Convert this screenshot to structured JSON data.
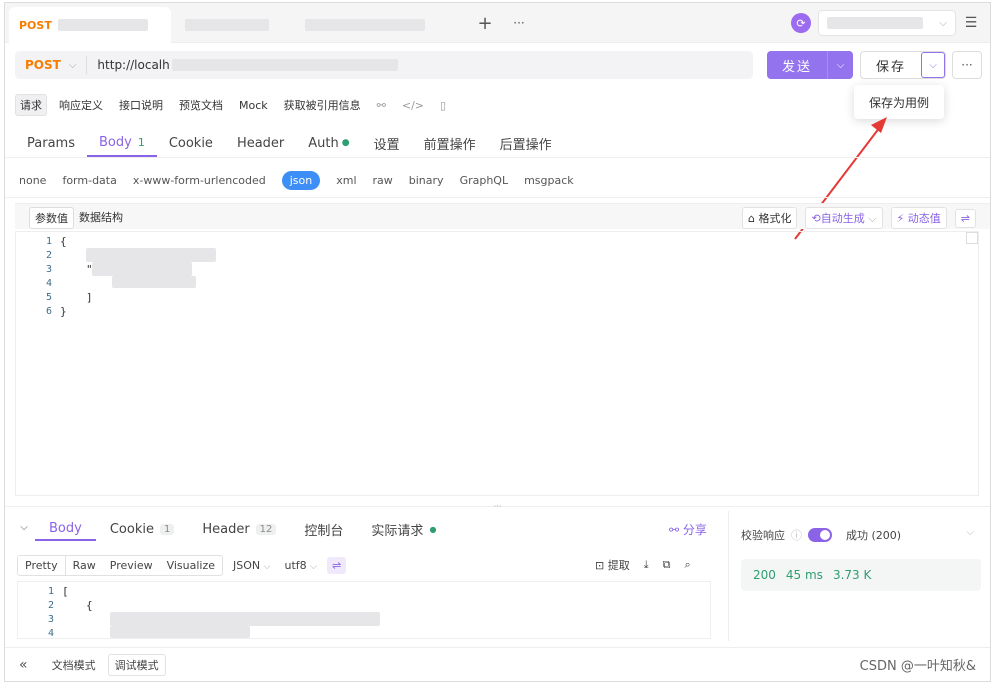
{
  "tabs": [
    {
      "method": "POST",
      "active": true
    },
    {
      "method": "",
      "active": false
    },
    {
      "method": "",
      "active": false
    }
  ],
  "tabbar": {
    "add": "+",
    "more": "···",
    "menu": "☰"
  },
  "request": {
    "method": "POST",
    "url": "http://localh",
    "send_label": "发送",
    "save_label": "保存",
    "dropdown_item": "保存为用例"
  },
  "subtabs": [
    "请求",
    "响应定义",
    "接口说明",
    "预览文档",
    "Mock",
    "获取被引用信息"
  ],
  "request_tabs": [
    {
      "label": "Params"
    },
    {
      "label": "Body",
      "count": "1"
    },
    {
      "label": "Cookie"
    },
    {
      "label": "Header"
    },
    {
      "label": "Auth"
    },
    {
      "label": "设置"
    },
    {
      "label": "前置操作"
    },
    {
      "label": "后置操作"
    }
  ],
  "body_types": [
    "none",
    "form-data",
    "x-www-form-urlencoded",
    "json",
    "xml",
    "raw",
    "binary",
    "GraphQL",
    "msgpack"
  ],
  "param_toolbar": {
    "tab1": "参数值",
    "tab2": "数据结构",
    "format": "格式化",
    "auto_gen": "自动生成",
    "dynamic": "动态值"
  },
  "code_lines": [
    {
      "n": "1",
      "text": "{"
    },
    {
      "n": "2",
      "text": ""
    },
    {
      "n": "3",
      "text": "\""
    },
    {
      "n": "4",
      "text": ""
    },
    {
      "n": "5",
      "text": "]"
    },
    {
      "n": "6",
      "text": "}"
    }
  ],
  "response_tabs": [
    {
      "label": "Body"
    },
    {
      "label": "Cookie",
      "count": "1"
    },
    {
      "label": "Header",
      "count": "12"
    },
    {
      "label": "控制台"
    },
    {
      "label": "实际请求"
    }
  ],
  "share_label": "分享",
  "format_modes": [
    "Pretty",
    "Raw",
    "Preview",
    "Visualize"
  ],
  "format_type": "JSON",
  "encoding": "utf8",
  "extract_label": "提取",
  "response_lines": [
    {
      "n": "1",
      "text": "["
    },
    {
      "n": "2",
      "text": "{"
    },
    {
      "n": "3",
      "text": ""
    },
    {
      "n": "4",
      "text": ""
    }
  ],
  "validate": {
    "label": "校验响应",
    "result": "成功 (200)"
  },
  "status": {
    "code": "200",
    "time": "45 ms",
    "size": "3.73 K"
  },
  "footer": {
    "doc_mode": "文档模式",
    "debug_mode": "调试模式",
    "right_text": "CSDN @一叶知秋&"
  },
  "colors": {
    "accent": "#8a63e6",
    "method": "#f77d00",
    "success": "#2e9d70",
    "json_pill": "#3d8ef7"
  }
}
